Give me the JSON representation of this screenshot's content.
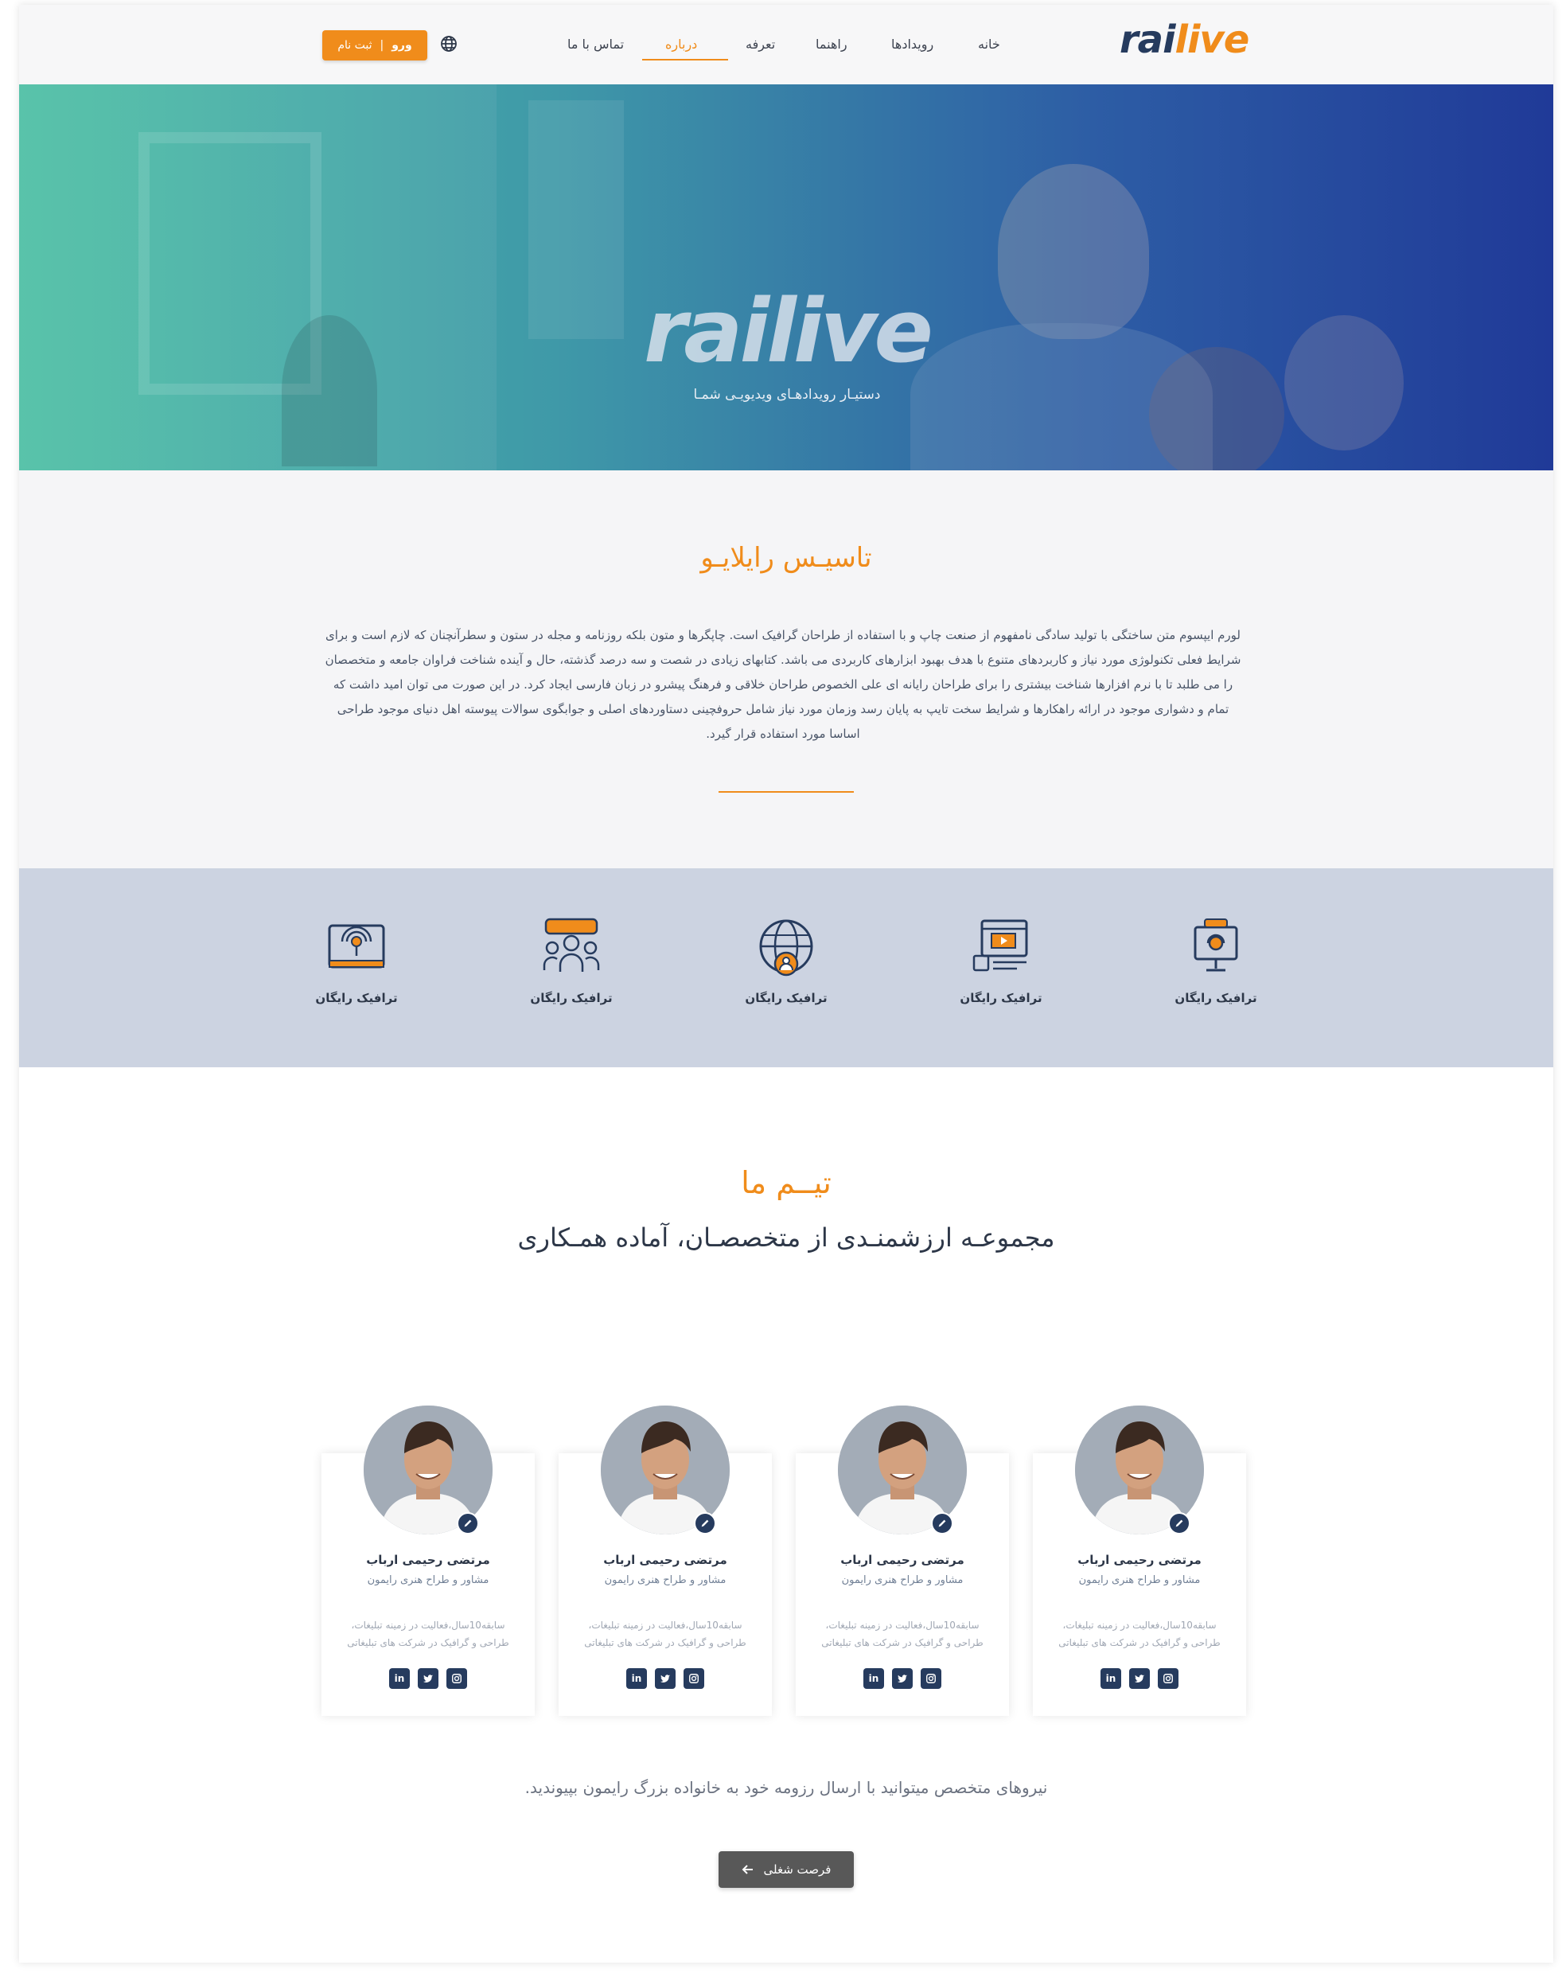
{
  "header": {
    "logo": {
      "part1": "rai",
      "part2": "live"
    },
    "nav": [
      "خانه",
      "رویدادها",
      "راهنما",
      "تعرفه",
      "درباره",
      "تماس با ما"
    ],
    "active_nav": "درباره",
    "auth": {
      "login": "ورو",
      "separator": "|",
      "register": "ثبت نام"
    },
    "globe_icon": "globe-icon"
  },
  "hero": {
    "logo": "railive",
    "subtitle": "دستیـار رویدادهـای ویدیویـی شمـا"
  },
  "about": {
    "title": "تاسیـس رایلایـو",
    "text": "لورم ایپسوم متن ساختگی با تولید سادگی نامفهوم از صنعت چاپ و با استفاده از طراحان گرافیک است. چاپگرها و متون بلکه روزنامه و مجله در ستون و سطرآنچنان که لازم است و برای شرایط فعلی تکنولوژی مورد نیاز و کاربردهای متنوع با هدف بهبود ابزارهای کاربردی می باشد. کتابهای زیادی در شصت و سه درصد گذشته، حال و آینده شناخت فراوان جامعه و متخصصان را می طلبد تا با نرم افزارها شناخت بیشتری را برای طراحان رایانه ای علی الخصوص طراحان خلاقی و فرهنگ پیشرو در زبان فارسی ایجاد کرد. در این صورت می توان امید داشت که تمام و دشواری موجود در ارائه راهکارها و شرایط سخت تایپ به پایان رسد وزمان مورد نیاز شامل حروفچینی دستاوردهای اصلی و جوابگوی سوالات پیوسته اهل دنیای موجود طراحی اساسا مورد استفاده قرار گیرد."
  },
  "features": [
    {
      "label": "ترافیک رایگان",
      "icon": "support-monitor-icon"
    },
    {
      "label": "ترافیک رایگان",
      "icon": "video-player-icon"
    },
    {
      "label": "ترافیک رایگان",
      "icon": "global-user-icon"
    },
    {
      "label": "ترافیک رایگان",
      "icon": "team-chat-icon"
    },
    {
      "label": "ترافیک رایگان",
      "icon": "live-broadcast-icon"
    }
  ],
  "team": {
    "title": "تیــم ما",
    "subtitle": "مجموعـه ارزشمنـدی از متخصصـان، آماده همـکاری",
    "members": [
      {
        "name": "مرتضی رحیمی ارباب",
        "role": "مشاور و طراح هنری رایمون",
        "bio1": "سابقه10سال،فعالیت در زمینه تبلیغات،",
        "bio2": "طراحی و گرافیک در شرکت های تبلیغاتی"
      },
      {
        "name": "مرتضی رحیمی ارباب",
        "role": "مشاور و طراح هنری رایمون",
        "bio1": "سابقه10سال،فعالیت در زمینه تبلیغات،",
        "bio2": "طراحی و گرافیک در شرکت های تبلیغاتی"
      },
      {
        "name": "مرتضی رحیمی ارباب",
        "role": "مشاور و طراح هنری رایمون",
        "bio1": "سابقه10سال،فعالیت در زمینه تبلیغات،",
        "bio2": "طراحی و گرافیک در شرکت های تبلیغاتی"
      },
      {
        "name": "مرتضی رحیمی ارباب",
        "role": "مشاور و طراح هنری رایمون",
        "bio1": "سابقه10سال،فعالیت در زمینه تبلیغات،",
        "bio2": "طراحی و گرافیک در شرکت های تبلیغاتی"
      }
    ],
    "social_icons": [
      "instagram-icon",
      "twitter-icon",
      "linkedin-icon"
    ]
  },
  "join": {
    "text": "نیروهای متخصص میتوانید با ارسال رزومه خود به خانواده بزرگ رایمون بپیوندید.",
    "button": "فرصت شغلی"
  },
  "colors": {
    "accent": "#f08c1b",
    "navy": "#263b5e",
    "features_bg": "#ccd3e1"
  }
}
